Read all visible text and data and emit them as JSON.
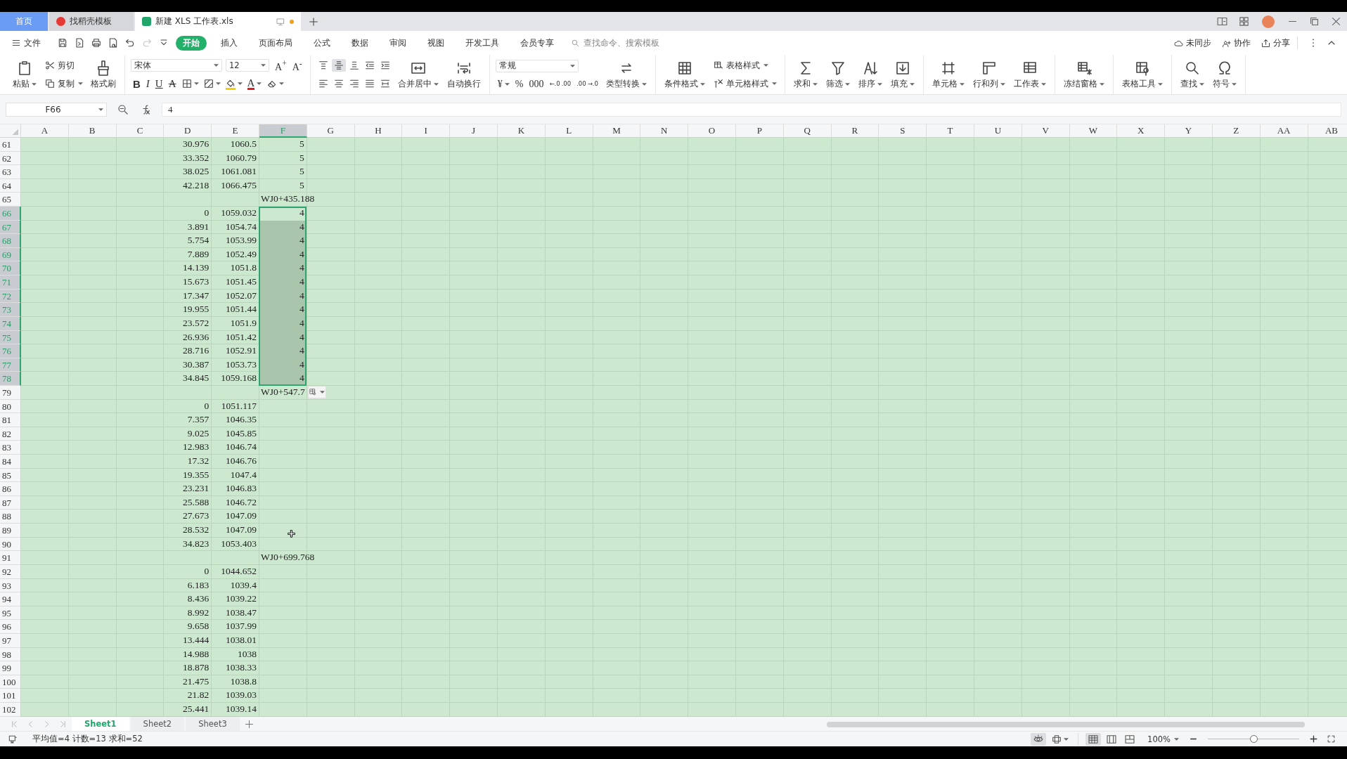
{
  "tabs": [
    {
      "label": "首页",
      "kind": "home",
      "selected": false,
      "modified": false
    },
    {
      "label": "找稻壳模板",
      "kind": "store",
      "selected": false,
      "modified": false
    },
    {
      "label": "新建 XLS 工作表.xls",
      "kind": "sheet",
      "selected": true,
      "modified": true
    }
  ],
  "quick_access": [
    {
      "disabled": false
    },
    {
      "disabled": false
    },
    {
      "disabled": false
    },
    {
      "disabled": false
    },
    {
      "disabled": false
    },
    {
      "disabled": true
    },
    {
      "disabled": false
    }
  ],
  "menu": {
    "file": "文件",
    "items": [
      {
        "label": "开始",
        "selected": true
      },
      {
        "label": "插入",
        "selected": false
      },
      {
        "label": "页面布局",
        "selected": false
      },
      {
        "label": "公式",
        "selected": false
      },
      {
        "label": "数据",
        "selected": false
      },
      {
        "label": "审阅",
        "selected": false
      },
      {
        "label": "视图",
        "selected": false
      },
      {
        "label": "开发工具",
        "selected": false
      },
      {
        "label": "会员专享",
        "selected": false
      }
    ],
    "search": {
      "placeholder": "查找命令、搜索模板"
    },
    "actions": [
      "未同步",
      "协作",
      "分享"
    ]
  },
  "ribbon": {
    "groups": [
      [
        [
          [
            {
              "kind": "large",
              "label": "粘贴",
              "dropdown": true
            }
          ]
        ],
        [
          [
            {
              "kind": "small",
              "label": "剪切",
              "dropdown": false
            }
          ],
          [
            {
              "kind": "small",
              "label": "复制",
              "dropdown": true
            }
          ]
        ],
        [
          [
            {
              "kind": "large",
              "label": "格式刷",
              "dropdown": false
            }
          ]
        ]
      ],
      [
        [
          [
            {
              "kind": "field",
              "value": "宋体"
            },
            {
              "kind": "field",
              "value": "12"
            },
            {
              "kind": "glyph",
              "label": "A$^{+}$",
              "dropdown": false
            },
            {
              "kind": "glyph",
              "label": "A$^{-}$",
              "dropdown": false
            }
          ],
          [
            {
              "kind": "bold",
              "label": "B",
              "dropdown": false
            },
            {
              "kind": "italic",
              "label": "I",
              "dropdown": false
            },
            {
              "kind": "underline",
              "label": "U",
              "dropdown": false
            },
            {
              "kind": "strike",
              "label": "A",
              "dropdown": false
            },
            {
              "kind": "icon",
              "dropdown": true
            },
            {
              "kind": "icon",
              "dropdown": true
            },
            {
              "kind": "icon",
              "dropdown": true,
              "color": "#f5d000"
            },
            {
              "kind": "fontcolor",
              "label": "A",
              "dropdown": true,
              "color": "#e02020"
            },
            {
              "kind": "icon",
              "dropdown": true
            }
          ]
        ]
      ],
      [
        [
          [
            {
              "kind": "icon",
              "selected": false,
              "dropdown": false
            },
            {
              "kind": "icon",
              "selected": true,
              "dropdown": false
            },
            {
              "kind": "icon",
              "selected": false,
              "dropdown": false
            },
            {
              "kind": "icon",
              "selected": false,
              "dropdown": false
            },
            {
              "kind": "icon",
              "selected": false,
              "dropdown": false
            }
          ],
          [
            {
              "kind": "icon",
              "selected": false,
              "dropdown": false
            },
            {
              "kind": "icon",
              "selected": false,
              "dropdown": false
            },
            {
              "kind": "icon",
              "selected": false,
              "dropdown": false
            },
            {
              "kind": "icon",
              "selected": false,
              "dropdown": false
            },
            {
              "kind": "icon",
              "selected": false,
              "dropdown": false
            }
          ]
        ],
        [
          [
            {
              "kind": "large",
              "label": "合并居中",
              "dropdown": true
            }
          ]
        ],
        [
          [
            {
              "kind": "large",
              "label": "自动换行",
              "dropdown": false
            }
          ]
        ]
      ],
      [
        [
          [
            {
              "kind": "field",
              "value": "常规"
            }
          ],
          [
            {
              "kind": "glyph",
              "label": "¥",
              "dropdown": true
            },
            {
              "kind": "glyph",
              "label": "%",
              "dropdown": false
            },
            {
              "kind": "glyph",
              "label": "000",
              "dropdown": false
            },
            {
              "kind": "stacked",
              "label": "←.0 .00",
              "dropdown": false
            },
            {
              "kind": "stacked",
              "label": ".00 →.0",
              "dropdown": false
            }
          ]
        ],
        [
          [
            {
              "kind": "large",
              "label": "类型转换",
              "dropdown": true
            }
          ]
        ]
      ],
      [
        [
          [
            {
              "kind": "large",
              "label": "条件格式",
              "dropdown": true
            }
          ]
        ],
        [
          [
            {
              "kind": "small",
              "label": "表格样式",
              "dropdown": true
            }
          ],
          [
            {
              "kind": "small",
              "label": "单元格样式",
              "dropdown": true
            }
          ]
        ]
      ],
      [
        [
          [
            {
              "kind": "large",
              "label": "求和",
              "dropdown": true
            }
          ]
        ],
        [
          [
            {
              "kind": "large",
              "label": "筛选",
              "dropdown": true
            }
          ]
        ],
        [
          [
            {
              "kind": "large",
              "label": "排序",
              "dropdown": true
            }
          ]
        ],
        [
          [
            {
              "kind": "large",
              "label": "填充",
              "dropdown": true
            }
          ]
        ]
      ],
      [
        [
          [
            {
              "kind": "large",
              "label": "单元格",
              "dropdown": true
            }
          ]
        ],
        [
          [
            {
              "kind": "large",
              "label": "行和列",
              "dropdown": true
            }
          ]
        ],
        [
          [
            {
              "kind": "large",
              "label": "工作表",
              "dropdown": true
            }
          ]
        ]
      ],
      [
        [
          [
            {
              "kind": "large",
              "label": "冻结窗格",
              "dropdown": true
            }
          ]
        ]
      ],
      [
        [
          [
            {
              "kind": "large",
              "label": "表格工具",
              "dropdown": true
            }
          ]
        ]
      ],
      [
        [
          [
            {
              "kind": "large",
              "label": "查找",
              "dropdown": true
            }
          ]
        ],
        [
          [
            {
              "kind": "large",
              "label": "符号",
              "dropdown": true
            }
          ]
        ]
      ]
    ]
  },
  "formula_bar": {
    "name_box": "F66",
    "formula": "4"
  },
  "table": {
    "columns": [
      {
        "label": "A",
        "selected": false
      },
      {
        "label": "B",
        "selected": false
      },
      {
        "label": "C",
        "selected": false
      },
      {
        "label": "D",
        "selected": false
      },
      {
        "label": "E",
        "selected": false
      },
      {
        "label": "F",
        "selected": true
      },
      {
        "label": "G",
        "selected": false
      },
      {
        "label": "H",
        "selected": false
      },
      {
        "label": "I",
        "selected": false
      },
      {
        "label": "J",
        "selected": false
      },
      {
        "label": "K",
        "selected": false
      },
      {
        "label": "L",
        "selected": false
      },
      {
        "label": "M",
        "selected": false
      },
      {
        "label": "N",
        "selected": false
      },
      {
        "label": "O",
        "selected": false
      },
      {
        "label": "P",
        "selected": false
      },
      {
        "label": "Q",
        "selected": false
      },
      {
        "label": "R",
        "selected": false
      },
      {
        "label": "S",
        "selected": false
      },
      {
        "label": "T",
        "selected": false
      },
      {
        "label": "U",
        "selected": false
      },
      {
        "label": "V",
        "selected": false
      },
      {
        "label": "W",
        "selected": false
      },
      {
        "label": "X",
        "selected": false
      },
      {
        "label": "Y",
        "selected": false
      },
      {
        "label": "Z",
        "selected": false
      },
      {
        "label": "AA",
        "selected": false
      },
      {
        "label": "AB",
        "selected": false
      }
    ],
    "rows": [
      {
        "n": "61",
        "selected": false,
        "cells": [
          {
            "kind": "empty"
          },
          {
            "kind": "empty"
          },
          {
            "kind": "empty"
          },
          {
            "kind": "number",
            "text": "30.976"
          },
          {
            "kind": "number",
            "text": "1060.5"
          },
          {
            "kind": "number",
            "text": "5"
          }
        ]
      },
      {
        "n": "62",
        "selected": false,
        "cells": [
          {
            "kind": "empty"
          },
          {
            "kind": "empty"
          },
          {
            "kind": "empty"
          },
          {
            "kind": "number",
            "text": "33.352"
          },
          {
            "kind": "number",
            "text": "1060.79"
          },
          {
            "kind": "number",
            "text": "5"
          }
        ]
      },
      {
        "n": "63",
        "selected": false,
        "cells": [
          {
            "kind": "empty"
          },
          {
            "kind": "empty"
          },
          {
            "kind": "empty"
          },
          {
            "kind": "number",
            "text": "38.025"
          },
          {
            "kind": "number",
            "text": "1061.081"
          },
          {
            "kind": "number",
            "text": "5"
          }
        ]
      },
      {
        "n": "64",
        "selected": false,
        "cells": [
          {
            "kind": "empty"
          },
          {
            "kind": "empty"
          },
          {
            "kind": "empty"
          },
          {
            "kind": "number",
            "text": "42.218"
          },
          {
            "kind": "number",
            "text": "1066.475"
          },
          {
            "kind": "number",
            "text": "5"
          }
        ]
      },
      {
        "n": "65",
        "selected": false,
        "cells": [
          {
            "kind": "empty"
          },
          {
            "kind": "empty"
          },
          {
            "kind": "empty"
          },
          {
            "kind": "empty"
          },
          {
            "kind": "empty"
          },
          {
            "kind": "text",
            "text": "WJ0+435.188"
          }
        ]
      },
      {
        "n": "66",
        "selected": true,
        "cells": [
          {
            "kind": "empty"
          },
          {
            "kind": "empty"
          },
          {
            "kind": "empty"
          },
          {
            "kind": "number",
            "text": "0"
          },
          {
            "kind": "number",
            "text": "1059.032"
          },
          {
            "kind": "number",
            "text": "4"
          }
        ]
      },
      {
        "n": "67",
        "selected": true,
        "cells": [
          {
            "kind": "empty"
          },
          {
            "kind": "empty"
          },
          {
            "kind": "empty"
          },
          {
            "kind": "number",
            "text": "3.891"
          },
          {
            "kind": "number",
            "text": "1054.74"
          },
          {
            "kind": "number",
            "text": "4"
          }
        ]
      },
      {
        "n": "68",
        "selected": true,
        "cells": [
          {
            "kind": "empty"
          },
          {
            "kind": "empty"
          },
          {
            "kind": "empty"
          },
          {
            "kind": "number",
            "text": "5.754"
          },
          {
            "kind": "number",
            "text": "1053.99"
          },
          {
            "kind": "number",
            "text": "4"
          }
        ]
      },
      {
        "n": "69",
        "selected": true,
        "cells": [
          {
            "kind": "empty"
          },
          {
            "kind": "empty"
          },
          {
            "kind": "empty"
          },
          {
            "kind": "number",
            "text": "7.889"
          },
          {
            "kind": "number",
            "text": "1052.49"
          },
          {
            "kind": "number",
            "text": "4"
          }
        ]
      },
      {
        "n": "70",
        "selected": true,
        "cells": [
          {
            "kind": "empty"
          },
          {
            "kind": "empty"
          },
          {
            "kind": "empty"
          },
          {
            "kind": "number",
            "text": "14.139"
          },
          {
            "kind": "number",
            "text": "1051.8"
          },
          {
            "kind": "number",
            "text": "4"
          }
        ]
      },
      {
        "n": "71",
        "selected": true,
        "cells": [
          {
            "kind": "empty"
          },
          {
            "kind": "empty"
          },
          {
            "kind": "empty"
          },
          {
            "kind": "number",
            "text": "15.673"
          },
          {
            "kind": "number",
            "text": "1051.45"
          },
          {
            "kind": "number",
            "text": "4"
          }
        ]
      },
      {
        "n": "72",
        "selected": true,
        "cells": [
          {
            "kind": "empty"
          },
          {
            "kind": "empty"
          },
          {
            "kind": "empty"
          },
          {
            "kind": "number",
            "text": "17.347"
          },
          {
            "kind": "number",
            "text": "1052.07"
          },
          {
            "kind": "number",
            "text": "4"
          }
        ]
      },
      {
        "n": "73",
        "selected": true,
        "cells": [
          {
            "kind": "empty"
          },
          {
            "kind": "empty"
          },
          {
            "kind": "empty"
          },
          {
            "kind": "number",
            "text": "19.955"
          },
          {
            "kind": "number",
            "text": "1051.44"
          },
          {
            "kind": "number",
            "text": "4"
          }
        ]
      },
      {
        "n": "74",
        "selected": true,
        "cells": [
          {
            "kind": "empty"
          },
          {
            "kind": "empty"
          },
          {
            "kind": "empty"
          },
          {
            "kind": "number",
            "text": "23.572"
          },
          {
            "kind": "number",
            "text": "1051.9"
          },
          {
            "kind": "number",
            "text": "4"
          }
        ]
      },
      {
        "n": "75",
        "selected": true,
        "cells": [
          {
            "kind": "empty"
          },
          {
            "kind": "empty"
          },
          {
            "kind": "empty"
          },
          {
            "kind": "number",
            "text": "26.936"
          },
          {
            "kind": "number",
            "text": "1051.42"
          },
          {
            "kind": "number",
            "text": "4"
          }
        ]
      },
      {
        "n": "76",
        "selected": true,
        "cells": [
          {
            "kind": "empty"
          },
          {
            "kind": "empty"
          },
          {
            "kind": "empty"
          },
          {
            "kind": "number",
            "text": "28.716"
          },
          {
            "kind": "number",
            "text": "1052.91"
          },
          {
            "kind": "number",
            "text": "4"
          }
        ]
      },
      {
        "n": "77",
        "selected": true,
        "cells": [
          {
            "kind": "empty"
          },
          {
            "kind": "empty"
          },
          {
            "kind": "empty"
          },
          {
            "kind": "number",
            "text": "30.387"
          },
          {
            "kind": "number",
            "text": "1053.73"
          },
          {
            "kind": "number",
            "text": "4"
          }
        ]
      },
      {
        "n": "78",
        "selected": true,
        "cells": [
          {
            "kind": "empty"
          },
          {
            "kind": "empty"
          },
          {
            "kind": "empty"
          },
          {
            "kind": "number",
            "text": "34.845"
          },
          {
            "kind": "number",
            "text": "1059.168"
          },
          {
            "kind": "number",
            "text": "4"
          }
        ]
      },
      {
        "n": "79",
        "selected": false,
        "paste_options": true,
        "cells": [
          {
            "kind": "empty"
          },
          {
            "kind": "empty"
          },
          {
            "kind": "empty"
          },
          {
            "kind": "empty"
          },
          {
            "kind": "empty"
          },
          {
            "kind": "text",
            "text": "WJ0+547.7"
          }
        ]
      },
      {
        "n": "80",
        "selected": false,
        "cells": [
          {
            "kind": "empty"
          },
          {
            "kind": "empty"
          },
          {
            "kind": "empty"
          },
          {
            "kind": "number",
            "text": "0"
          },
          {
            "kind": "number",
            "text": "1051.117"
          }
        ]
      },
      {
        "n": "81",
        "selected": false,
        "cells": [
          {
            "kind": "empty"
          },
          {
            "kind": "empty"
          },
          {
            "kind": "empty"
          },
          {
            "kind": "number",
            "text": "7.357"
          },
          {
            "kind": "number",
            "text": "1046.35"
          }
        ]
      },
      {
        "n": "82",
        "selected": false,
        "cells": [
          {
            "kind": "empty"
          },
          {
            "kind": "empty"
          },
          {
            "kind": "empty"
          },
          {
            "kind": "number",
            "text": "9.025"
          },
          {
            "kind": "number",
            "text": "1045.85"
          }
        ]
      },
      {
        "n": "83",
        "selected": false,
        "cells": [
          {
            "kind": "empty"
          },
          {
            "kind": "empty"
          },
          {
            "kind": "empty"
          },
          {
            "kind": "number",
            "text": "12.983"
          },
          {
            "kind": "number",
            "text": "1046.74"
          }
        ]
      },
      {
        "n": "84",
        "selected": false,
        "cells": [
          {
            "kind": "empty"
          },
          {
            "kind": "empty"
          },
          {
            "kind": "empty"
          },
          {
            "kind": "number",
            "text": "17.32"
          },
          {
            "kind": "number",
            "text": "1046.76"
          }
        ]
      },
      {
        "n": "85",
        "selected": false,
        "cells": [
          {
            "kind": "empty"
          },
          {
            "kind": "empty"
          },
          {
            "kind": "empty"
          },
          {
            "kind": "number",
            "text": "19.355"
          },
          {
            "kind": "number",
            "text": "1047.4"
          }
        ]
      },
      {
        "n": "86",
        "selected": false,
        "cells": [
          {
            "kind": "empty"
          },
          {
            "kind": "empty"
          },
          {
            "kind": "empty"
          },
          {
            "kind": "number",
            "text": "23.231"
          },
          {
            "kind": "number",
            "text": "1046.83"
          }
        ]
      },
      {
        "n": "87",
        "selected": false,
        "cells": [
          {
            "kind": "empty"
          },
          {
            "kind": "empty"
          },
          {
            "kind": "empty"
          },
          {
            "kind": "number",
            "text": "25.588"
          },
          {
            "kind": "number",
            "text": "1046.72"
          }
        ]
      },
      {
        "n": "88",
        "selected": false,
        "cells": [
          {
            "kind": "empty"
          },
          {
            "kind": "empty"
          },
          {
            "kind": "empty"
          },
          {
            "kind": "number",
            "text": "27.673"
          },
          {
            "kind": "number",
            "text": "1047.09"
          }
        ]
      },
      {
        "n": "89",
        "selected": false,
        "cells": [
          {
            "kind": "empty"
          },
          {
            "kind": "empty"
          },
          {
            "kind": "empty"
          },
          {
            "kind": "number",
            "text": "28.532"
          },
          {
            "kind": "number",
            "text": "1047.09"
          }
        ]
      },
      {
        "n": "90",
        "selected": false,
        "cells": [
          {
            "kind": "empty"
          },
          {
            "kind": "empty"
          },
          {
            "kind": "empty"
          },
          {
            "kind": "number",
            "text": "34.823"
          },
          {
            "kind": "number",
            "text": "1053.403"
          }
        ]
      },
      {
        "n": "91",
        "selected": false,
        "cells": [
          {
            "kind": "empty"
          },
          {
            "kind": "empty"
          },
          {
            "kind": "empty"
          },
          {
            "kind": "empty"
          },
          {
            "kind": "empty"
          },
          {
            "kind": "text",
            "text": "WJ0+699.768"
          }
        ]
      },
      {
        "n": "92",
        "selected": false,
        "cells": [
          {
            "kind": "empty"
          },
          {
            "kind": "empty"
          },
          {
            "kind": "empty"
          },
          {
            "kind": "number",
            "text": "0"
          },
          {
            "kind": "number",
            "text": "1044.652"
          }
        ]
      },
      {
        "n": "93",
        "selected": false,
        "cells": [
          {
            "kind": "empty"
          },
          {
            "kind": "empty"
          },
          {
            "kind": "empty"
          },
          {
            "kind": "number",
            "text": "6.183"
          },
          {
            "kind": "number",
            "text": "1039.4"
          }
        ]
      },
      {
        "n": "94",
        "selected": false,
        "cells": [
          {
            "kind": "empty"
          },
          {
            "kind": "empty"
          },
          {
            "kind": "empty"
          },
          {
            "kind": "number",
            "text": "8.436"
          },
          {
            "kind": "number",
            "text": "1039.22"
          }
        ]
      },
      {
        "n": "95",
        "selected": false,
        "cells": [
          {
            "kind": "empty"
          },
          {
            "kind": "empty"
          },
          {
            "kind": "empty"
          },
          {
            "kind": "number",
            "text": "8.992"
          },
          {
            "kind": "number",
            "text": "1038.47"
          }
        ]
      },
      {
        "n": "96",
        "selected": false,
        "cells": [
          {
            "kind": "empty"
          },
          {
            "kind": "empty"
          },
          {
            "kind": "empty"
          },
          {
            "kind": "number",
            "text": "9.658"
          },
          {
            "kind": "number",
            "text": "1037.99"
          }
        ]
      },
      {
        "n": "97",
        "selected": false,
        "cells": [
          {
            "kind": "empty"
          },
          {
            "kind": "empty"
          },
          {
            "kind": "empty"
          },
          {
            "kind": "number",
            "text": "13.444"
          },
          {
            "kind": "number",
            "text": "1038.01"
          }
        ]
      },
      {
        "n": "98",
        "selected": false,
        "cells": [
          {
            "kind": "empty"
          },
          {
            "kind": "empty"
          },
          {
            "kind": "empty"
          },
          {
            "kind": "number",
            "text": "14.988"
          },
          {
            "kind": "number",
            "text": "1038"
          }
        ]
      },
      {
        "n": "99",
        "selected": false,
        "cells": [
          {
            "kind": "empty"
          },
          {
            "kind": "empty"
          },
          {
            "kind": "empty"
          },
          {
            "kind": "number",
            "text": "18.878"
          },
          {
            "kind": "number",
            "text": "1038.33"
          }
        ]
      },
      {
        "n": "100",
        "selected": false,
        "cells": [
          {
            "kind": "empty"
          },
          {
            "kind": "empty"
          },
          {
            "kind": "empty"
          },
          {
            "kind": "number",
            "text": "21.475"
          },
          {
            "kind": "number",
            "text": "1038.8"
          }
        ]
      },
      {
        "n": "101",
        "selected": false,
        "cells": [
          {
            "kind": "empty"
          },
          {
            "kind": "empty"
          },
          {
            "kind": "empty"
          },
          {
            "kind": "number",
            "text": "21.82"
          },
          {
            "kind": "number",
            "text": "1039.03"
          }
        ]
      },
      {
        "n": "102",
        "selected": false,
        "cells": [
          {
            "kind": "empty"
          },
          {
            "kind": "empty"
          },
          {
            "kind": "empty"
          },
          {
            "kind": "number",
            "text": "25.441"
          },
          {
            "kind": "number",
            "text": "1039.14"
          }
        ]
      }
    ]
  },
  "sheets": [
    {
      "label": "Sheet1",
      "selected": true
    },
    {
      "label": "Sheet2",
      "selected": false
    },
    {
      "label": "Sheet3",
      "selected": false
    }
  ],
  "status_bar": {
    "summary": "平均值=4 计数=13 求和=52",
    "eye_protection": {
      "on": true
    },
    "views": [
      {
        "selected": true
      },
      {
        "selected": false
      },
      {
        "selected": false
      }
    ],
    "zoom": "100%",
    "zoom_slider": {
      "level": 0.5
    }
  }
}
